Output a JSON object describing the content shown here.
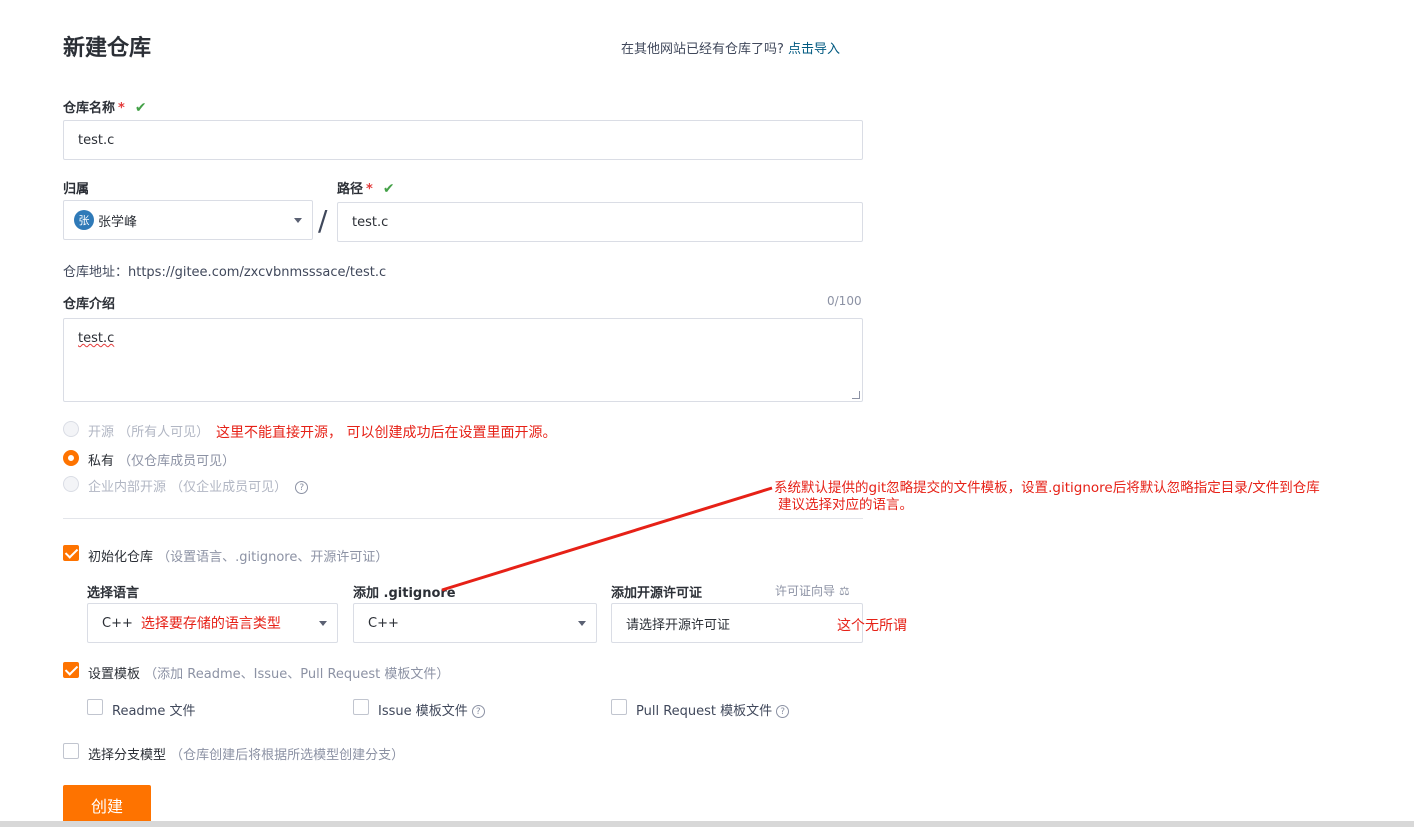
{
  "header": {
    "title": "新建仓库",
    "import_question": "在其他网站已经有仓库了吗?",
    "import_link": "点击导入"
  },
  "repo_name": {
    "label": "仓库名称",
    "required_mark": "*",
    "valid_mark": "✔",
    "value": "test.c"
  },
  "owner": {
    "label": "归属",
    "avatar_char": "张",
    "value": "张学峰"
  },
  "path": {
    "label": "路径",
    "required_mark": "*",
    "valid_mark": "✔",
    "separator": "/",
    "value": "test.c"
  },
  "repo_address": "仓库地址：https://gitee.com/zxcvbnmsssace/test.c",
  "description": {
    "label": "仓库介绍",
    "counter": "0/100",
    "value": "test.c"
  },
  "visibility": {
    "options": [
      {
        "label": "开源",
        "sub": "（所有人可见）",
        "selected": false,
        "disabled": true
      },
      {
        "label": "私有",
        "sub": "（仅仓库成员可见）",
        "selected": true,
        "disabled": false
      },
      {
        "label": "企业内部开源",
        "sub": "（仅企业成员可见）",
        "selected": false,
        "disabled": true
      }
    ],
    "help_icon": "question-circle-icon"
  },
  "init_repo": {
    "checked": true,
    "label": "初始化仓库",
    "sub": "（设置语言、.gitignore、开源许可证）",
    "language": {
      "label": "选择语言",
      "value": "C++"
    },
    "gitignore": {
      "label": "添加 .gitignore",
      "value": "C++"
    },
    "license": {
      "label": "添加开源许可证",
      "guide": "许可证向导",
      "guide_icon": "scale-icon",
      "placeholder": "请选择开源许可证"
    }
  },
  "template": {
    "checked": true,
    "label": "设置模板",
    "sub": "（添加 Readme、Issue、Pull Request 模板文件）",
    "items": [
      {
        "label": "Readme 文件",
        "checked": false,
        "help": false
      },
      {
        "label": "Issue 模板文件",
        "checked": false,
        "help": true
      },
      {
        "label": "Pull Request 模板文件",
        "checked": false,
        "help": true
      }
    ]
  },
  "branch_model": {
    "checked": false,
    "label": "选择分支模型",
    "sub": "（仓库创建后将根据所选模型创建分支）"
  },
  "create_button": "创建",
  "annotations": {
    "open_source_note": "这里不能直接开源， 可以创建成功后在设置里面开源。",
    "gitignore_note_1": "系统默认提供的git忽略提交的文件模板，设置.gitignore后将默认忽略指定目录/文件到仓库",
    "gitignore_note_2": "建议选择对应的语言。",
    "language_note": "选择要存储的语言类型",
    "license_note": "这个无所谓",
    "note_color": "#e62117"
  },
  "colors": {
    "accent": "#fe7300",
    "link": "#005980",
    "valid": "#44a148"
  }
}
